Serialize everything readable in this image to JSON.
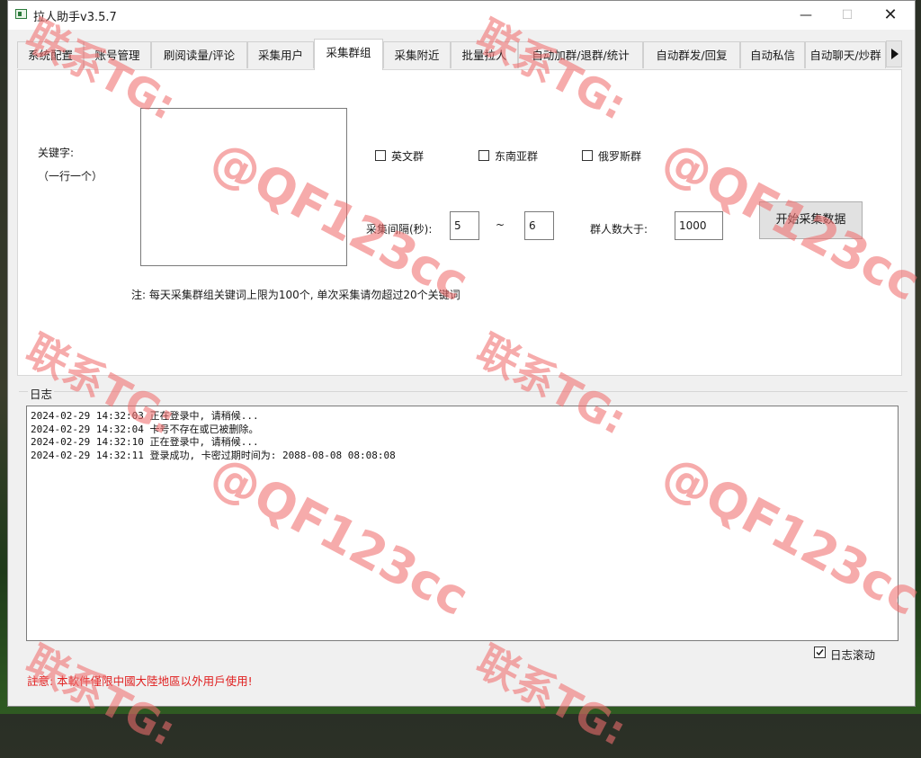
{
  "window": {
    "title": "拉人助手v3.5.7",
    "min_icon": "—",
    "max_icon": "☐",
    "close_icon": "✕"
  },
  "tabs": [
    {
      "label": "系统配置"
    },
    {
      "label": "账号管理"
    },
    {
      "label": "刷阅读量/评论"
    },
    {
      "label": "采集用户"
    },
    {
      "label": "采集群组",
      "active": true
    },
    {
      "label": "采集附近"
    },
    {
      "label": "批量拉人"
    },
    {
      "label": "自动加群/退群/统计"
    },
    {
      "label": "自动群发/回复"
    },
    {
      "label": "自动私信"
    },
    {
      "label": "自动聊天/炒群"
    }
  ],
  "form": {
    "keyword_label": "关键字:",
    "keyword_hint": "（一行一个）",
    "keywords_value": "",
    "checkboxes": [
      {
        "label": "英文群",
        "checked": false
      },
      {
        "label": "东南亚群",
        "checked": false
      },
      {
        "label": "俄罗斯群",
        "checked": false
      }
    ],
    "interval_label": "采集间隔(秒):",
    "interval_min": "5",
    "interval_sep": "~",
    "interval_max": "6",
    "member_label": "群人数大于:",
    "member_value": "1000",
    "start_button": "开始采集数据",
    "note": "注: 每天采集群组关键词上限为100个, 单次采集请勿超过20个关键词"
  },
  "log": {
    "title": "日志",
    "lines": [
      "2024-02-29 14:32:03 正在登录中, 请稍候...",
      "2024-02-29 14:32:04 卡号不存在或已被删除。",
      "2024-02-29 14:32:10 正在登录中, 请稍候...",
      "2024-02-29 14:32:11 登录成功, 卡密过期时间为: 2088-08-08 08:08:08"
    ],
    "autoscroll_label": "日志滚动",
    "autoscroll_checked": true
  },
  "notice": "註意: 本軟件僅限中國大陸地區以外用戶使用!",
  "watermark": {
    "line1": "联系TG:",
    "line2": "@QF123cc"
  },
  "colors": {
    "notice": "#e02020",
    "watermark": "#f07070"
  }
}
